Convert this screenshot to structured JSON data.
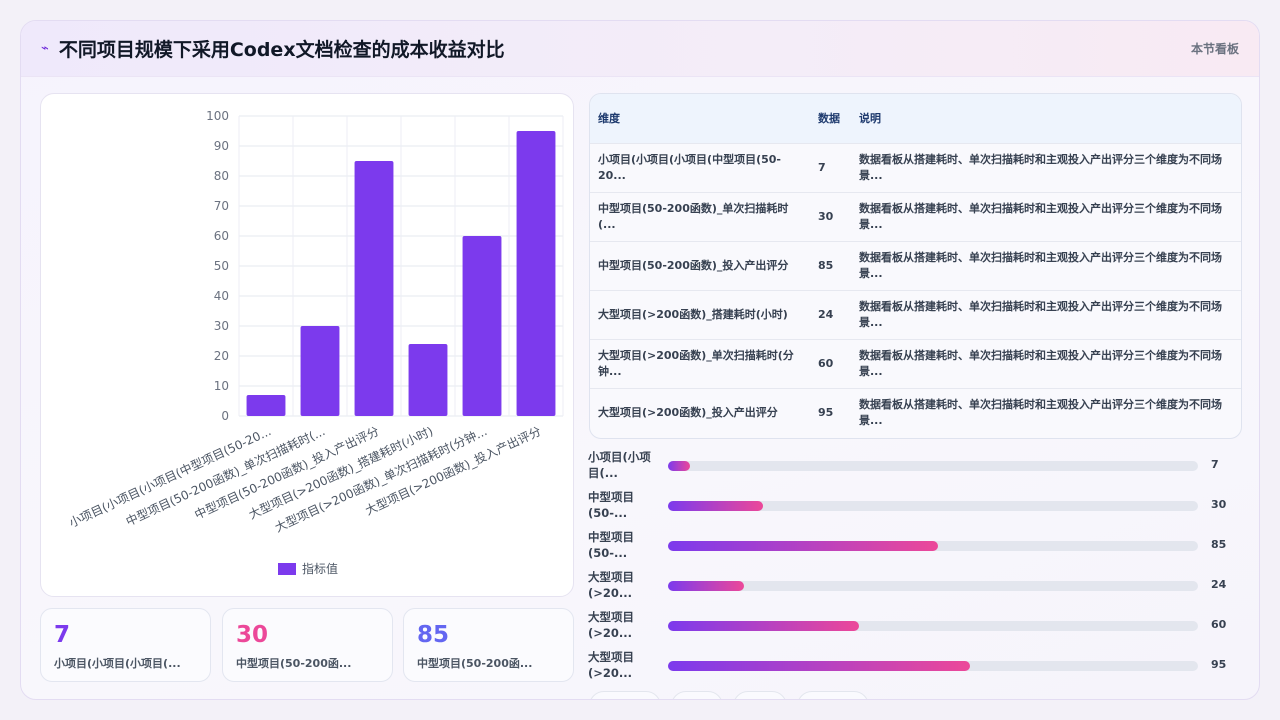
{
  "header": {
    "icon": "sparkle-icon",
    "title": "不同项目规模下采用Codex文档检查的成本收益对比",
    "tag": "本节看板"
  },
  "chart_data": {
    "type": "bar",
    "categories": [
      "小项目(小项目(小项目(中型项目(50-20...",
      "中型项目(50-200函数)_单次扫描耗时(...",
      "中型项目(50-200函数)_投入产出评分",
      "大型项目(>200函数)_搭建耗时(小时)",
      "大型项目(>200函数)_单次扫描耗时(分钟...",
      "大型项目(>200函数)_投入产出评分"
    ],
    "series": [
      {
        "name": "指标值",
        "values": [
          7,
          30,
          85,
          24,
          60,
          95
        ],
        "color": "#7c3aed"
      }
    ],
    "ylim": [
      0,
      100
    ],
    "yticks": [
      0,
      10,
      20,
      30,
      40,
      50,
      60,
      70,
      80,
      90,
      100
    ],
    "grid": true,
    "legend": "bottom"
  },
  "kpis": [
    {
      "value": "7",
      "label": "小项目(小项目(小项目(...",
      "color": "#7c3aed"
    },
    {
      "value": "30",
      "label": "中型项目(50-200函...",
      "color": "#ec4899"
    },
    {
      "value": "85",
      "label": "中型项目(50-200函...",
      "color": "#6366f1"
    }
  ],
  "table": {
    "headers": [
      "维度",
      "数据",
      "说明"
    ],
    "rows": [
      {
        "dim": "小项目(小项目(小项目(中型项目(50-20...",
        "val": "7",
        "desc": "数据看板从搭建耗时、单次扫描耗时和主观投入产出评分三个维度为不同场景..."
      },
      {
        "dim": "中型项目(50-200函数)_单次扫描耗时(...",
        "val": "30",
        "desc": "数据看板从搭建耗时、单次扫描耗时和主观投入产出评分三个维度为不同场景..."
      },
      {
        "dim": "中型项目(50-200函数)_投入产出评分",
        "val": "85",
        "desc": "数据看板从搭建耗时、单次扫描耗时和主观投入产出评分三个维度为不同场景..."
      },
      {
        "dim": "大型项目(>200函数)_搭建耗时(小时)",
        "val": "24",
        "desc": "数据看板从搭建耗时、单次扫描耗时和主观投入产出评分三个维度为不同场景..."
      },
      {
        "dim": "大型项目(>200函数)_单次扫描耗时(分钟...",
        "val": "60",
        "desc": "数据看板从搭建耗时、单次扫描耗时和主观投入产出评分三个维度为不同场景..."
      },
      {
        "dim": "大型项目(>200函数)_投入产出评分",
        "val": "95",
        "desc": "数据看板从搭建耗时、单次扫描耗时和主观投入产出评分三个维度为不同场景..."
      }
    ]
  },
  "progress": [
    {
      "label": "小项目(小项目(...",
      "value": 7
    },
    {
      "label": "中型项目(50-...",
      "value": 30
    },
    {
      "label": "中型项目(50-...",
      "value": 85
    },
    {
      "label": "大型项目(>20...",
      "value": 24
    },
    {
      "label": "大型项目(>20...",
      "value": 60
    },
    {
      "label": "大型项目(>20...",
      "value": 95
    }
  ]
}
